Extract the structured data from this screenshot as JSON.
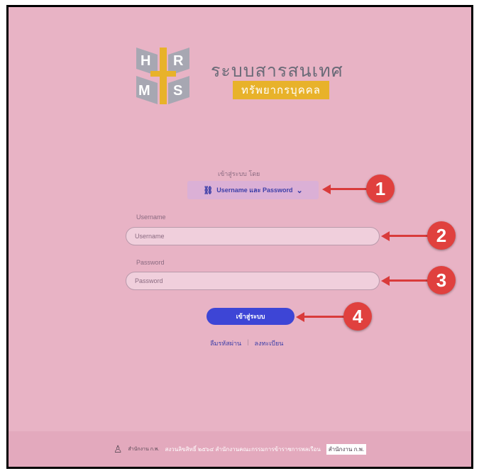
{
  "brand": {
    "logo_text": "HRMS",
    "title": "ระบบสารสนเทศ",
    "subtitle": "ทรัพยากรบุคคล",
    "accent_color": "#e8b22a"
  },
  "login": {
    "via_label": "เข้าสู่ระบบ โดย",
    "method_icon": "link-icon",
    "method_label": "Username และ Password",
    "username_label": "Username",
    "username_placeholder": "Username",
    "password_label": "Password",
    "password_placeholder": "Password",
    "submit_label": "เข้าสู่ระบบ",
    "forgot_label": "ลืมรหัสผ่าน",
    "register_label": "ลงทะเบียน",
    "primary_color": "#3d45d6"
  },
  "footer": {
    "office_logo_text": "สำนักงาน ก.พ.",
    "copyright": "สงวนลิขสิทธิ์ ๒๕๖๔ สำนักงานคณะกรรมการข้าราชการพลเรือน",
    "highlight": "สำนักงาน ก.พ."
  },
  "annotations": {
    "marker_1": "1",
    "marker_2": "2",
    "marker_3": "3",
    "marker_4": "4",
    "color": "#e0403e"
  }
}
